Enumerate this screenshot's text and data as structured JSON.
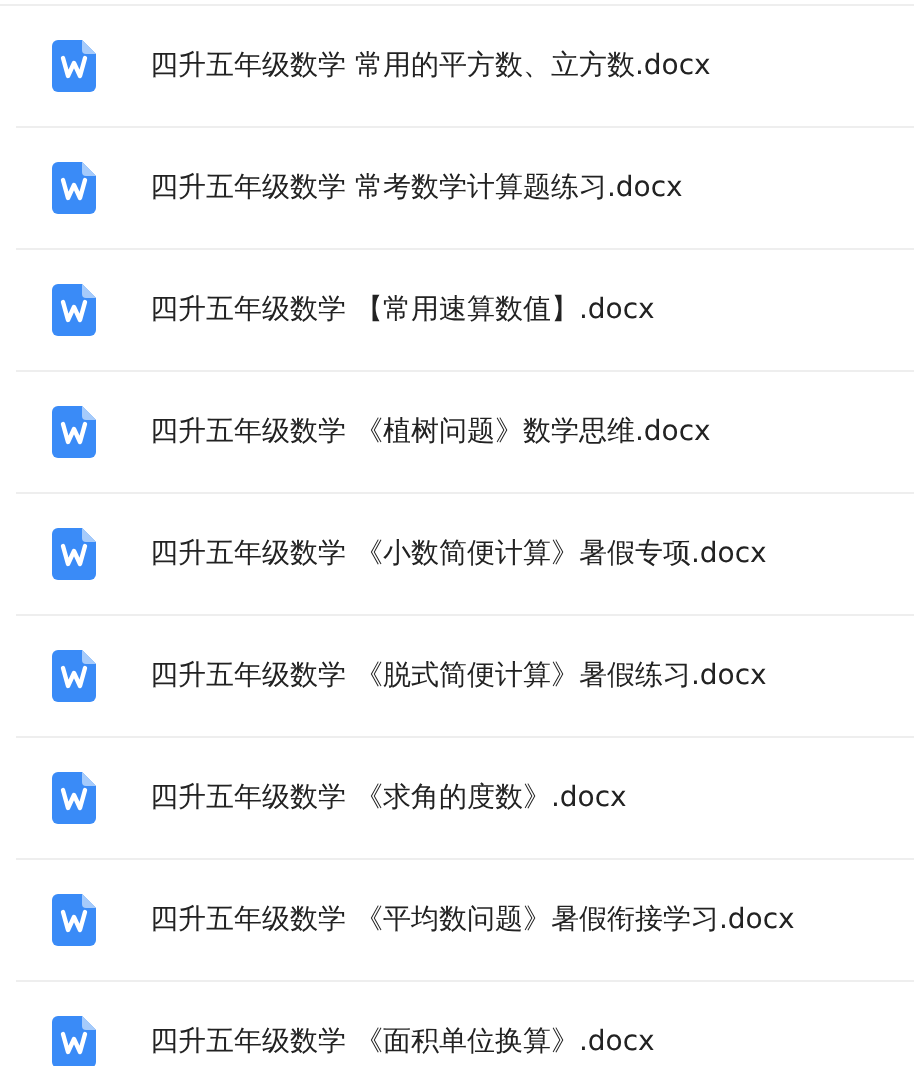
{
  "files": [
    {
      "name": "四升五年级数学 常用的平方数、立方数.docx"
    },
    {
      "name": "四升五年级数学 常考数学计算题练习.docx"
    },
    {
      "name": "四升五年级数学 【常用速算数值】.docx"
    },
    {
      "name": "四升五年级数学 《植树问题》数学思维.docx"
    },
    {
      "name": "四升五年级数学 《小数简便计算》暑假专项.docx"
    },
    {
      "name": "四升五年级数学 《脱式简便计算》暑假练习.docx"
    },
    {
      "name": "四升五年级数学 《求角的度数》.docx"
    },
    {
      "name": "四升五年级数学 《平均数问题》暑假衔接学习.docx"
    },
    {
      "name": "四升五年级数学 《面积单位换算》.docx"
    }
  ]
}
